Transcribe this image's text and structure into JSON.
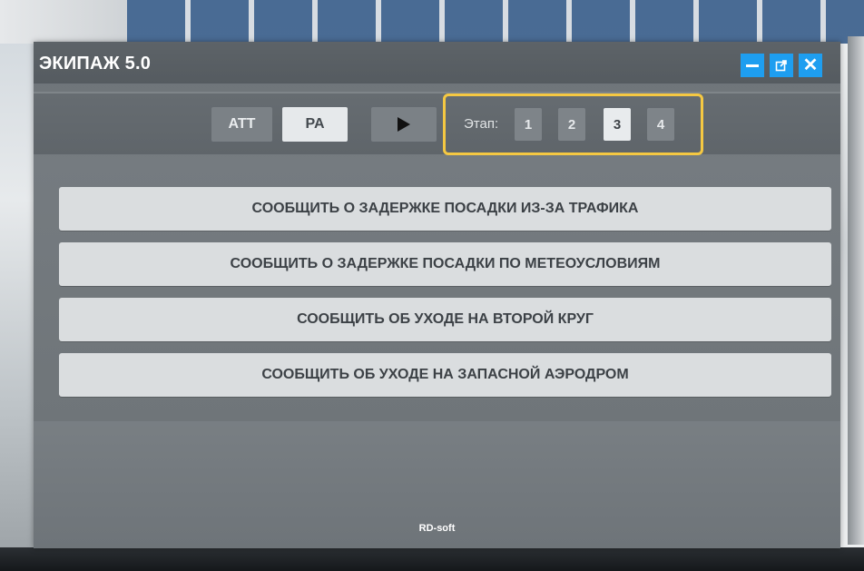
{
  "window": {
    "title": "ЭКИПАЖ 5.0",
    "controls": {
      "minimize": "minimize",
      "popout": "popout",
      "close": "✕"
    },
    "footer": "RD-soft"
  },
  "toolbar": {
    "att_label": "ATT",
    "pa_label": "PA",
    "play_icon": "play-icon",
    "stage_label": "Этап:",
    "stages": [
      "1",
      "2",
      "3",
      "4"
    ],
    "selected_stage": "3",
    "selected_mode": "PA"
  },
  "actions": [
    "СООБЩИТЬ О ЗАДЕРЖКЕ ПОСАДКИ ИЗ-ЗА ТРАФИКА",
    "СООБЩИТЬ О ЗАДЕРЖКЕ ПОСАДКИ ПО МЕТЕОУСЛОВИЯМ",
    "СООБЩИТЬ ОБ УХОДЕ НА ВТОРОЙ КРУГ",
    "СООБЩИТЬ ОБ УХОДЕ НА ЗАПАСНОЙ АЭРОДРОМ"
  ],
  "colors": {
    "accent_blue": "#1e9ef0",
    "highlight_yellow": "#f5c842",
    "active_button": "#e6e9eb",
    "inactive_button": "#7b8186"
  }
}
